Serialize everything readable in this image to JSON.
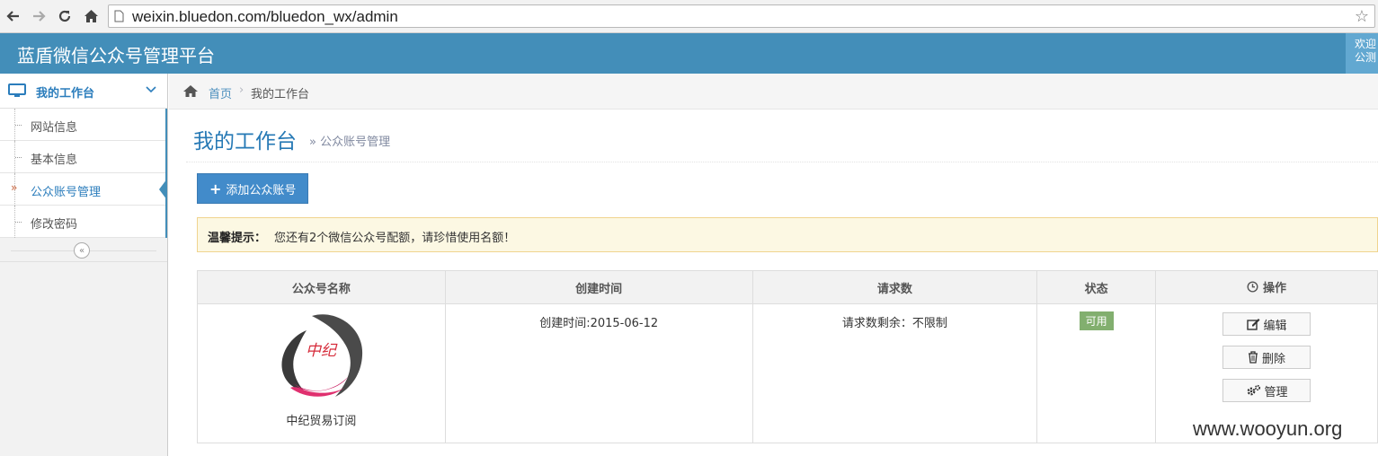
{
  "browser": {
    "url": "weixin.bluedon.com/bluedon_wx/admin"
  },
  "header": {
    "brand": "蓝盾微信公众号管理平台",
    "welcome_line1": "欢迎",
    "welcome_line2": "公测"
  },
  "sidebar": {
    "top": {
      "label": "我的工作台"
    },
    "items": [
      {
        "label": "网站信息"
      },
      {
        "label": "基本信息"
      },
      {
        "label": "公众账号管理",
        "active": true
      },
      {
        "label": "修改密码"
      }
    ]
  },
  "breadcrumb": {
    "home": "首页",
    "current": "我的工作台",
    "separator": "›"
  },
  "page": {
    "title": "我的工作台",
    "subtitle": "» 公众账号管理"
  },
  "toolbar": {
    "add_label": "添加公众账号"
  },
  "alert": {
    "strong": "温馨提示：",
    "message": "您还有2个微信公众号配额，请珍惜使用名额！"
  },
  "table": {
    "headers": {
      "name": "公众号名称",
      "created": "创建时间",
      "requests": "请求数",
      "status": "状态",
      "actions": "操作"
    },
    "rows": [
      {
        "name": "中纪贸易订阅",
        "logo_text": "中纪",
        "created": "创建时间:2015-06-12",
        "requests": "请求数剩余：不限制",
        "status": "可用",
        "actions": {
          "edit": "编辑",
          "delete": "删除",
          "manage": "管理"
        }
      }
    ]
  },
  "watermark": "www.wooyun.org",
  "colors": {
    "header_bg": "#438eb9",
    "title": "#2679b5",
    "primary_button": "#428bca",
    "status_ok": "#82af6f",
    "alert_bg": "#fcf8e3"
  }
}
